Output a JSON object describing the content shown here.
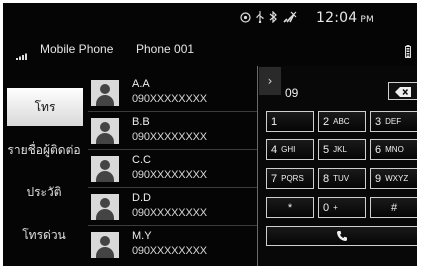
{
  "status_bar": {
    "icons": [
      "location-pin-icon",
      "usb-icon",
      "bluetooth-icon",
      "no-signal-icon"
    ],
    "time": "12:04",
    "ampm": "PM"
  },
  "header": {
    "signal_icon": "signal-bars-icon",
    "carrier": "Mobile Phone",
    "phone_name": "Phone 001",
    "battery_icon": "battery-icon"
  },
  "nav": {
    "items": [
      {
        "label": "โทร",
        "active": true
      },
      {
        "label": "รายชื่อผู้ติดต่อ",
        "active": false
      },
      {
        "label": "ประวัติ",
        "active": false
      },
      {
        "label": "โทรด่วน",
        "active": false
      }
    ]
  },
  "contacts": [
    {
      "name": "A.A",
      "number": "090XXXXXXXX"
    },
    {
      "name": "B.B",
      "number": "090XXXXXXXX"
    },
    {
      "name": "C.C",
      "number": "090XXXXXXXX"
    },
    {
      "name": "D.D",
      "number": "090XXXXXXXX"
    },
    {
      "name": "M.Y",
      "number": "090XXXXXXXX"
    }
  ],
  "dialpad": {
    "display": "09",
    "collapse_glyph": "›",
    "keys": [
      {
        "digit": "1",
        "letters": ""
      },
      {
        "digit": "2",
        "letters": "ABC"
      },
      {
        "digit": "3",
        "letters": "DEF"
      },
      {
        "digit": "4",
        "letters": "GHI"
      },
      {
        "digit": "5",
        "letters": "JKL"
      },
      {
        "digit": "6",
        "letters": "MNO"
      },
      {
        "digit": "7",
        "letters": "PQRS"
      },
      {
        "digit": "8",
        "letters": "TUV"
      },
      {
        "digit": "9",
        "letters": "WXYZ"
      },
      {
        "digit": "*",
        "letters": ""
      },
      {
        "digit": "0",
        "letters": "+"
      },
      {
        "digit": "#",
        "letters": ""
      }
    ]
  }
}
